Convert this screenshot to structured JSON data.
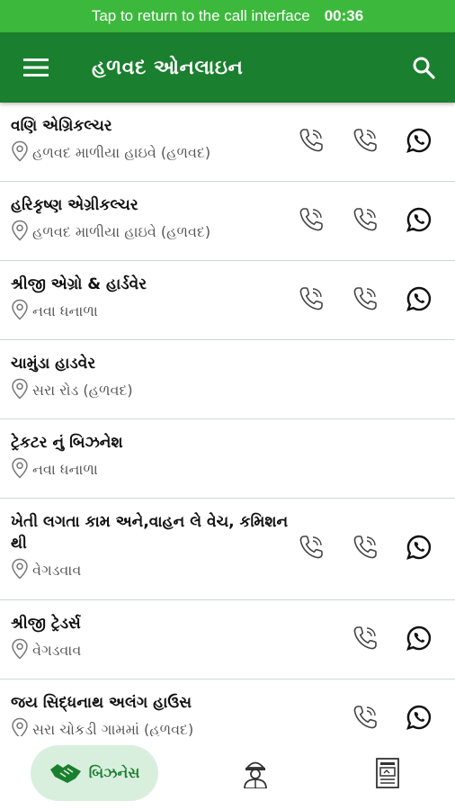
{
  "call_banner": {
    "text": "Tap to return to the call interface",
    "timer": "00:36"
  },
  "app_bar": {
    "title": "હળવદ ઓનલાઇન",
    "menu_icon": "hamburger-menu-icon",
    "search_icon": "search-icon"
  },
  "colors": {
    "banner": "#3cb93c",
    "app_bar": "#1a7f2e",
    "divider": "#c9dbd3",
    "nav_active_bg": "#d9efde",
    "whatsapp": "#111111"
  },
  "listings": [
    {
      "name": "વણિ એગ્રિકલ્ચર",
      "location": "હળવદ માળીયા હાઇવે (હળવદ)",
      "actions": [
        "phone",
        "phone",
        "whatsapp"
      ]
    },
    {
      "name": "હરિકૃષ્ણ  એગ્રીકલ્ચર",
      "location": "હળવદ માળીયા હાઇવે (હળવદ)",
      "actions": [
        "phone",
        "phone",
        "whatsapp"
      ]
    },
    {
      "name": "શ્રીજી એગ્રો & હાર્ડવેર",
      "location": "નવા ધનાળા",
      "actions": [
        "phone",
        "phone",
        "whatsapp"
      ]
    },
    {
      "name": "ચામુંડા હાડવેર",
      "location": "સરા રોડ (હળવદ)",
      "actions": []
    },
    {
      "name": "ટ્રેકટર  નું બિઝનેશ",
      "location": "નવા ધનાળા",
      "actions": []
    },
    {
      "name": "ખેતી લગતા કામ અને,વાહન લે વેચ, કમિશન થી",
      "location": "વેગડવાવ",
      "actions": [
        "phone",
        "phone",
        "whatsapp"
      ]
    },
    {
      "name": "શ્રીજી ટ્રેડર્સ",
      "location": "વેગડવાવ",
      "actions": [
        "blank",
        "phone",
        "whatsapp"
      ]
    },
    {
      "name": "જય સિદ્ધનાથ અલંગ હાઉસ",
      "location": "સરા ચોકડી ગામમાં (હળવદ)",
      "actions": [
        "blank",
        "phone",
        "whatsapp"
      ]
    }
  ],
  "bottom_nav": {
    "business_label": "બિઝનેસ",
    "business_icon": "handshake-icon",
    "workers_icon": "worker-icon",
    "news_icon": "newspaper-icon"
  }
}
